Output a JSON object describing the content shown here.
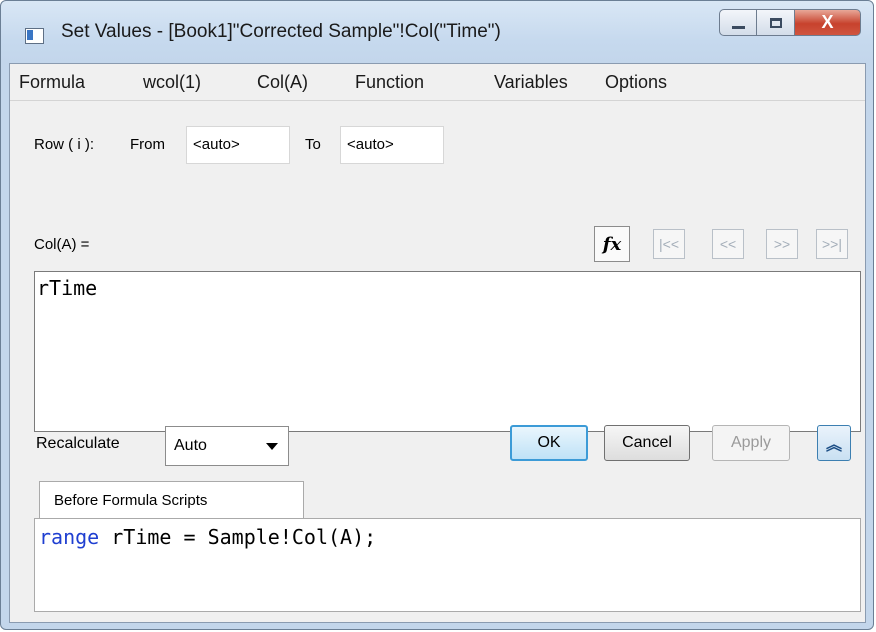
{
  "window": {
    "title": "Set Values - [Book1]\"Corrected Sample\"!Col(\"Time\")",
    "close_glyph": "X"
  },
  "menu": [
    "Formula",
    "wcol(1)",
    "Col(A)",
    "Function",
    "Variables",
    "Options"
  ],
  "row_range": {
    "row_label": "Row ( i ):",
    "from_label": "From",
    "from_value": "<auto>",
    "to_label": "To",
    "to_value": "<auto>"
  },
  "formula": {
    "label": "Col(A) =",
    "fx_glyph": "fx",
    "nav": [
      "|<<",
      "<<",
      ">>",
      ">>|"
    ],
    "text": "rTime"
  },
  "recalculate": {
    "label": "Recalculate",
    "selected": "Auto"
  },
  "buttons": {
    "ok": "OK",
    "cancel": "Cancel",
    "apply": "Apply",
    "expand_glyph": "︽"
  },
  "before_scripts": {
    "tab_label": "Before Formula Scripts",
    "keyword": "range",
    "rest": " rTime = Sample!Col(A);"
  }
}
